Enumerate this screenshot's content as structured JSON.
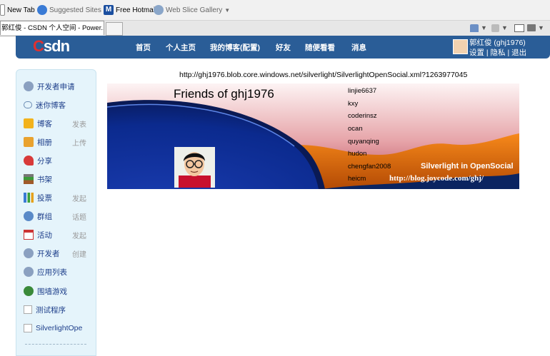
{
  "favorites": {
    "new_tab": "New Tab",
    "suggested_sites": "Suggested Sites",
    "free_hotmail": "Free Hotmail",
    "web_slice_gallery": "Web Slice Gallery"
  },
  "tab": {
    "title": "郭红俊 - CSDN 个人空间 - Power..."
  },
  "csdn": {
    "logo": "Csdn",
    "nav": [
      "首页",
      "个人主页",
      "我的博客(配置)",
      "好友",
      "随便看看",
      "消息"
    ],
    "user_name": "郭红俊 (ghj1976)",
    "user_links": "设置 | 隐私 | 退出"
  },
  "sidebar": {
    "items": [
      {
        "label": "开发者申请",
        "action": "",
        "icon": "developer-apply-icon"
      },
      {
        "label": "迷你博客",
        "action": "",
        "icon": "mini-blog-icon"
      },
      {
        "label": "博客",
        "action": "发表",
        "icon": "blog-icon"
      },
      {
        "label": "相册",
        "action": "上传",
        "icon": "album-icon"
      },
      {
        "label": "分享",
        "action": "",
        "icon": "share-icon"
      },
      {
        "label": "书架",
        "action": "",
        "icon": "bookshelf-icon"
      },
      {
        "label": "投票",
        "action": "发起",
        "icon": "vote-icon"
      },
      {
        "label": "群组",
        "action": "话题",
        "icon": "group-icon"
      },
      {
        "label": "活动",
        "action": "发起",
        "icon": "event-icon"
      },
      {
        "label": "开发者",
        "action": "创建",
        "icon": "developer-icon"
      },
      {
        "label": "应用列表",
        "action": "",
        "icon": "app-list-icon"
      },
      {
        "label": "围墙游戏",
        "action": "",
        "icon": "game-icon"
      },
      {
        "label": "测试程序",
        "action": "",
        "icon": "test-app-icon"
      },
      {
        "label": "SilverlightOpe",
        "action": "",
        "icon": "silverlight-app-icon"
      }
    ]
  },
  "gadget": {
    "url": "http://ghj1976.blob.core.windows.net/silverlight/SilverlightOpenSocial.xml?1263977045",
    "title": "Friends of ghj1976",
    "friends": [
      "linjie6637",
      "kxy",
      "coderinsz",
      "ocan",
      "quyanqing",
      "hudon",
      "chengfan2008",
      "heicm"
    ],
    "footer_title": "Silverlight in OpenSocial",
    "footer_url": "http://blog.joycode.com/ghj/"
  },
  "colors": {
    "nav_bar": "#2a5d97",
    "sidebar_bg": "#e5f4fb",
    "link_blue": "#1d3e8a",
    "banner_orange": "#f07a10"
  }
}
